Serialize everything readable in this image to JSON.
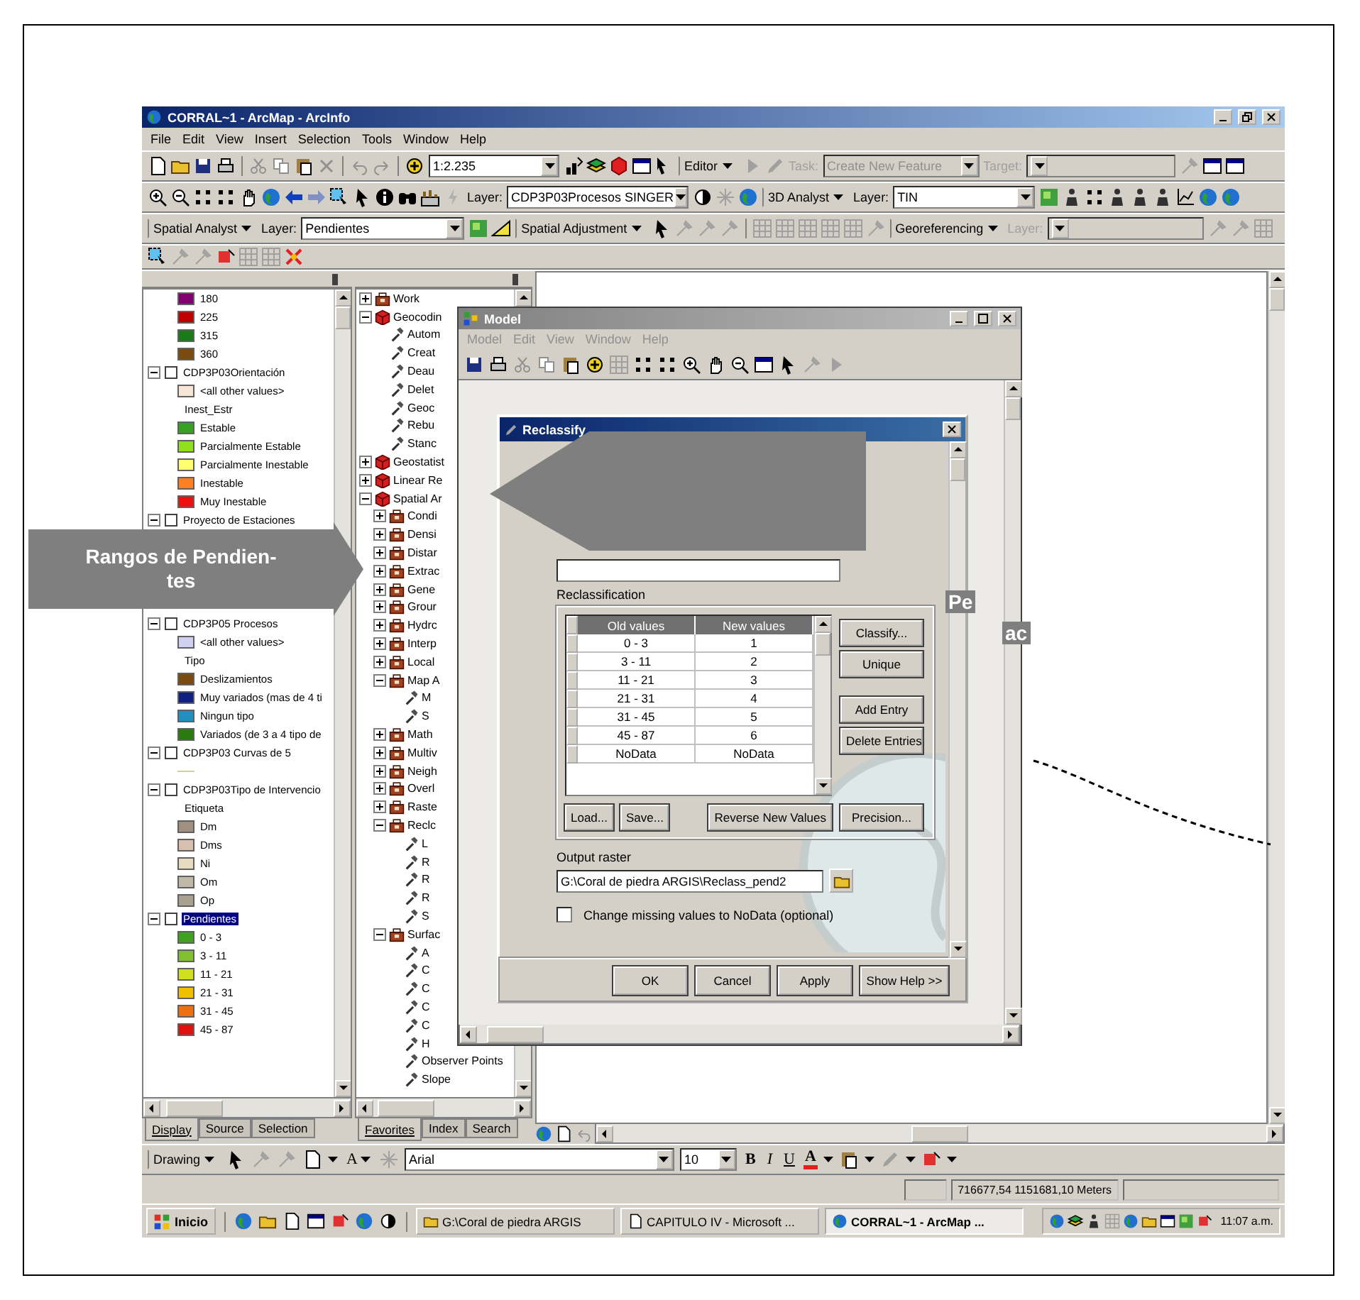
{
  "window": {
    "title": "CORRAL~1 - ArcMap - ArcInfo"
  },
  "menu": [
    "File",
    "Edit",
    "View",
    "Insert",
    "Selection",
    "Tools",
    "Window",
    "Help"
  ],
  "toolbars": [
    [
      {
        "kind": "icons"
      },
      {
        "kind": "combo",
        "value": "1:2.235",
        "disabled": false
      },
      {
        "kind": "icons"
      },
      {
        "kind": "menu",
        "label": "Editor"
      },
      {
        "kind": "icons"
      },
      {
        "kind": "label",
        "label": "Task:",
        "disabled": true
      },
      {
        "kind": "combo",
        "value": "Create New Feature",
        "disabled": true
      },
      {
        "kind": "label",
        "label": "Target:",
        "disabled": true
      },
      {
        "kind": "combo",
        "disabled": true
      },
      {
        "kind": "icons"
      }
    ],
    [
      {
        "kind": "icons"
      },
      {
        "kind": "label",
        "label": "Layer:",
        "disabled": false
      },
      {
        "kind": "combo",
        "value": "CDP3P03Procesos SINGER",
        "disabled": false
      },
      {
        "kind": "icons"
      },
      {
        "kind": "menu",
        "label": "3D Analyst"
      },
      {
        "kind": "label",
        "label": "Layer:",
        "disabled": false
      },
      {
        "kind": "combo",
        "value": "TIN",
        "disabled": false
      },
      {
        "kind": "icons"
      }
    ],
    [
      {
        "kind": "menu",
        "label": "Spatial Analyst"
      },
      {
        "kind": "label",
        "label": "Layer:",
        "disabled": false
      },
      {
        "kind": "combo",
        "value": "Pendientes",
        "disabled": false
      },
      {
        "kind": "icons"
      },
      {
        "kind": "menu",
        "label": "Spatial Adjustment"
      },
      {
        "kind": "icons"
      },
      {
        "kind": "menu",
        "label": "Georeferencing"
      },
      {
        "kind": "label",
        "label": "Layer:",
        "disabled": true
      },
      {
        "kind": "combo",
        "disabled": true
      },
      {
        "kind": "icons"
      }
    ],
    [
      {
        "kind": "icons"
      }
    ]
  ],
  "toc": {
    "legend_upper": [
      {
        "kind": "class",
        "label": "180",
        "color": "#800070"
      },
      {
        "kind": "class",
        "label": "225",
        "color": "#c00000"
      },
      {
        "kind": "class",
        "label": "315",
        "color": "#1a7a1a"
      },
      {
        "kind": "class",
        "label": "360",
        "color": "#7a4a10"
      },
      {
        "kind": "layer",
        "label": "CDP3P03Orientación",
        "expanded": true,
        "checked": false,
        "selected": false
      },
      {
        "kind": "class",
        "label": "<all other values>",
        "color": "#f5e6d8"
      },
      {
        "kind": "heading",
        "label": "Inest_Estr"
      },
      {
        "kind": "class",
        "label": "Estable",
        "color": "#38a020"
      },
      {
        "kind": "class",
        "label": "Parcialmente Estable",
        "color": "#90e020"
      },
      {
        "kind": "class",
        "label": "Parcialmente Inestable",
        "color": "#ffff70"
      },
      {
        "kind": "class",
        "label": "Inestable",
        "color": "#ff8020"
      },
      {
        "kind": "class",
        "label": "Muy Inestable",
        "color": "#ee1010"
      },
      {
        "kind": "layer",
        "label": "Proyecto de Estaciones",
        "expanded": true,
        "checked": false,
        "selected": false
      }
    ],
    "legend_lower": [
      {
        "kind": "layer",
        "label": "CDP3P05 Procesos",
        "expanded": true,
        "checked": false,
        "selected": false
      },
      {
        "kind": "class",
        "label": "<all other values>",
        "color": "#d0d0f0"
      },
      {
        "kind": "heading",
        "label": "Tipo"
      },
      {
        "kind": "class",
        "label": "Deslizamientos",
        "color": "#7a4a10"
      },
      {
        "kind": "class",
        "label": "Muy variados (mas de 4 ti",
        "color": "#102080"
      },
      {
        "kind": "class",
        "label": "Ningun tipo",
        "color": "#2090c0"
      },
      {
        "kind": "class",
        "label": "Variados (de 3 a 4 tipo de",
        "color": "#2a7a10"
      },
      {
        "kind": "layer",
        "label": "CDP3P03 Curvas de 5",
        "expanded": true,
        "checked": false,
        "selected": false
      },
      {
        "kind": "line",
        "color": "#d0d090"
      },
      {
        "kind": "layer",
        "label": "CDP3P03Tipo de Intervencio",
        "expanded": true,
        "checked": false,
        "selected": false
      },
      {
        "kind": "heading",
        "label": "Etiqueta"
      },
      {
        "kind": "class",
        "label": "Dm",
        "color": "#a09080"
      },
      {
        "kind": "class",
        "label": "Dms",
        "color": "#d8c0b0"
      },
      {
        "kind": "class",
        "label": "Ni",
        "color": "#e8dcc0"
      },
      {
        "kind": "class",
        "label": "Om",
        "color": "#c0b8a8"
      },
      {
        "kind": "class",
        "label": "Op",
        "color": "#a8a090"
      },
      {
        "kind": "layer",
        "label": "Pendientes",
        "expanded": true,
        "checked": false,
        "selected": true
      },
      {
        "kind": "class",
        "label": "0 - 3",
        "color": "#40a020"
      },
      {
        "kind": "class",
        "label": "3 - 11",
        "color": "#80c030"
      },
      {
        "kind": "class",
        "label": "11 - 21",
        "color": "#d0e020"
      },
      {
        "kind": "class",
        "label": "21 - 31",
        "color": "#f0c000"
      },
      {
        "kind": "class",
        "label": "31 - 45",
        "color": "#f07010"
      },
      {
        "kind": "class",
        "label": "45 - 87",
        "color": "#e01010"
      }
    ],
    "tabs": [
      {
        "label": "Display",
        "selected": true
      },
      {
        "label": "Source",
        "selected": false
      },
      {
        "label": "Selection",
        "selected": false
      }
    ]
  },
  "toolbox": {
    "tree": [
      {
        "kind": "toolset",
        "label": "Work",
        "expanded": false
      },
      {
        "kind": "toolbox",
        "label": "Geocodin",
        "expanded": true,
        "children": [
          {
            "kind": "tool",
            "label": "Autom"
          },
          {
            "kind": "tool",
            "label": "Creat"
          },
          {
            "kind": "tool",
            "label": "Deau"
          },
          {
            "kind": "tool",
            "label": "Delet"
          },
          {
            "kind": "tool",
            "label": "Geoc"
          },
          {
            "kind": "tool",
            "label": "Rebu"
          },
          {
            "kind": "tool",
            "label": "Stanc"
          }
        ]
      },
      {
        "kind": "toolbox",
        "label": "Geostatist",
        "expanded": false
      },
      {
        "kind": "toolbox",
        "label": "Linear Re",
        "expanded": false
      },
      {
        "kind": "toolbox",
        "label": "Spatial Ar",
        "expanded": true,
        "children": [
          {
            "kind": "toolset",
            "label": "Condi",
            "expanded": false
          },
          {
            "kind": "toolset",
            "label": "Densi",
            "expanded": false
          },
          {
            "kind": "toolset",
            "label": "Distar",
            "expanded": false
          },
          {
            "kind": "toolset",
            "label": "Extrac",
            "expanded": false
          },
          {
            "kind": "toolset",
            "label": "Gene",
            "expanded": false
          },
          {
            "kind": "toolset",
            "label": "Grour",
            "expanded": false
          },
          {
            "kind": "toolset",
            "label": "Hydrc",
            "expanded": false
          },
          {
            "kind": "toolset",
            "label": "Interp",
            "expanded": false
          },
          {
            "kind": "toolset",
            "label": "Local",
            "expanded": false
          },
          {
            "kind": "toolset",
            "label": "Map A",
            "expanded": true,
            "children": [
              {
                "kind": "tool",
                "label": "M"
              },
              {
                "kind": "tool",
                "label": "S"
              }
            ]
          },
          {
            "kind": "toolset",
            "label": "Math",
            "expanded": false
          },
          {
            "kind": "toolset",
            "label": "Multiv",
            "expanded": false
          },
          {
            "kind": "toolset",
            "label": "Neigh",
            "expanded": false
          },
          {
            "kind": "toolset",
            "label": "Overl",
            "expanded": false
          },
          {
            "kind": "toolset",
            "label": "Raste",
            "expanded": false
          },
          {
            "kind": "toolset",
            "label": "Reclc",
            "expanded": true,
            "children": [
              {
                "kind": "tool",
                "label": "L"
              },
              {
                "kind": "tool",
                "label": "R"
              },
              {
                "kind": "tool",
                "label": "R"
              },
              {
                "kind": "tool",
                "label": "R"
              },
              {
                "kind": "tool",
                "label": "S"
              }
            ]
          },
          {
            "kind": "toolset",
            "label": "Surfac",
            "expanded": true,
            "children": [
              {
                "kind": "tool",
                "label": "A"
              },
              {
                "kind": "tool",
                "label": "C"
              },
              {
                "kind": "tool",
                "label": "C"
              },
              {
                "kind": "tool",
                "label": "C"
              },
              {
                "kind": "tool",
                "label": "C"
              },
              {
                "kind": "tool",
                "label": "H"
              },
              {
                "kind": "tool",
                "label": "Observer Points"
              },
              {
                "kind": "tool",
                "label": "Slope"
              }
            ]
          }
        ]
      }
    ],
    "tabs": [
      {
        "label": "Favorites",
        "selected": true
      },
      {
        "label": "Index",
        "selected": false
      },
      {
        "label": "Search",
        "selected": false
      }
    ]
  },
  "model_window": {
    "title": "Model",
    "active": false,
    "menu": [
      "Model",
      "Edit",
      "View",
      "Window",
      "Help"
    ],
    "dialog": {
      "title": "Reclassify",
      "reclass_label": "Reclassification",
      "columns": [
        "Old values",
        "New values"
      ],
      "rows": [
        {
          "old": "0 - 3",
          "new": "1"
        },
        {
          "old": "3 - 11",
          "new": "2"
        },
        {
          "old": "11 - 21",
          "new": "3"
        },
        {
          "old": "21 - 31",
          "new": "4"
        },
        {
          "old": "31 - 45",
          "new": "5"
        },
        {
          "old": "45 - 87",
          "new": "6"
        },
        {
          "old": "NoData",
          "new": "NoData"
        }
      ],
      "side_buttons": [
        "Classify...",
        "Unique",
        "Add Entry",
        "Delete Entries"
      ],
      "bottom_buttons": [
        "Load...",
        "Save...",
        "Reverse New Values",
        "Precision..."
      ],
      "output_label": "Output raster",
      "output_value": "G:\\Coral de piedra ARGIS\\Reclass_pend2",
      "nodata_option": {
        "label": "Change missing values to NoData (optional)",
        "checked": false
      },
      "footer_buttons": [
        "OK",
        "Cancel",
        "Apply",
        "Show Help >>"
      ]
    }
  },
  "drawing_toolbar": {
    "menu": "Drawing",
    "text_tool": "A",
    "font": "Arial",
    "size": "10",
    "styles": [
      "B",
      "I",
      "U"
    ],
    "font_color": "A"
  },
  "status_bar": {
    "coordinates": "716677,54 1151681,10 Meters"
  },
  "taskbar": {
    "start": "Inicio",
    "tasks": [
      {
        "label": "G:\\Coral de piedra ARGIS",
        "selected": false
      },
      {
        "label": "CAPITULO IV - Microsoft ...",
        "selected": false
      },
      {
        "label": "CORRAL~1 - ArcMap ...",
        "selected": true
      }
    ],
    "clock": "11:07 a.m."
  },
  "callout_left": {
    "lines": [
      "Rangos de Pendien-",
      "tes"
    ]
  },
  "callout_right": {
    "lines": [
      "Pe",
      "ac"
    ]
  }
}
